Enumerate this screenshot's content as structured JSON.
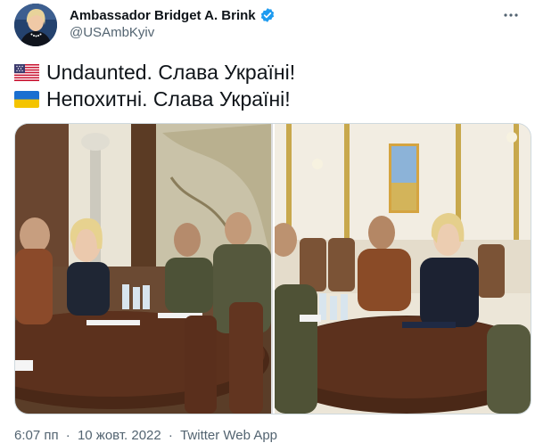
{
  "author": {
    "display_name": "Ambassador Bridget A. Brink",
    "handle": "@USAmbKyiv",
    "verified": true,
    "avatar_icon": "profile-photo-avatar"
  },
  "tweet": {
    "lines": [
      {
        "flag_icon": "us-flag-icon",
        "text": "Undaunted. Слава Україні!"
      },
      {
        "flag_icon": "ukraine-flag-icon",
        "text": "Непохитні. Слава Україні!"
      }
    ]
  },
  "media": {
    "photos": [
      {
        "icon": "meeting-photo-left"
      },
      {
        "icon": "meeting-photo-right"
      }
    ]
  },
  "footer": {
    "time": "6:07 пп",
    "date": "10 жовт. 2022",
    "source": "Twitter Web App",
    "separator": "·"
  },
  "colors": {
    "text_primary": "#0f1419",
    "text_secondary": "#536471",
    "verified_blue": "#1d9bf0",
    "border": "#cfd9de"
  }
}
